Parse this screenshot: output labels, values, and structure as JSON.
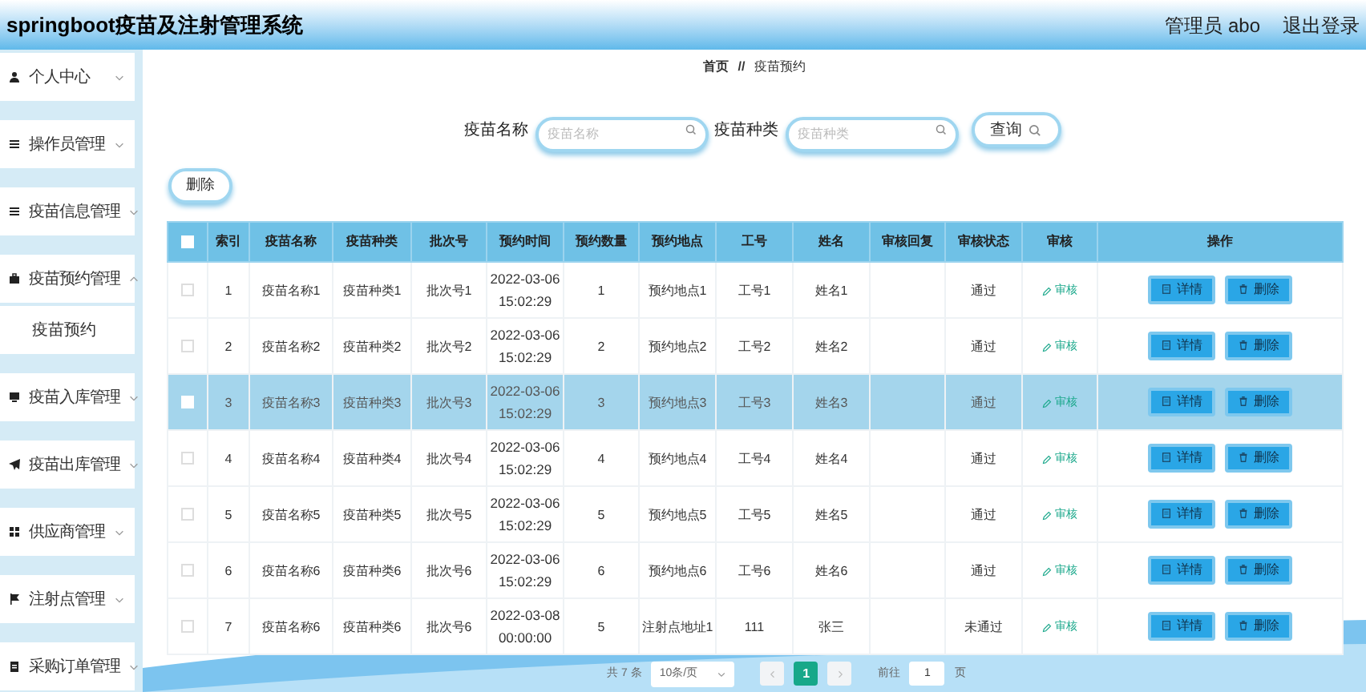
{
  "header": {
    "title": "springboot疫苗及注射管理系统",
    "user": "管理员 abo",
    "logout": "退出登录"
  },
  "sidebar": {
    "items": [
      {
        "label": "个人中心",
        "expanded": false
      },
      {
        "label": "操作员管理",
        "expanded": false
      },
      {
        "label": "疫苗信息管理",
        "expanded": false
      },
      {
        "label": "疫苗预约管理",
        "expanded": true,
        "children": [
          {
            "label": "疫苗预约"
          }
        ]
      },
      {
        "label": "疫苗入库管理",
        "expanded": false
      },
      {
        "label": "疫苗出库管理",
        "expanded": false
      },
      {
        "label": "供应商管理",
        "expanded": false
      },
      {
        "label": "注射点管理",
        "expanded": false
      },
      {
        "label": "采购订单管理",
        "expanded": false
      }
    ]
  },
  "breadcrumb": {
    "home": "首页",
    "separator": "//",
    "current": "疫苗预约"
  },
  "search": {
    "fields": [
      {
        "label": "疫苗名称",
        "placeholder": "疫苗名称"
      },
      {
        "label": "疫苗种类",
        "placeholder": "疫苗种类"
      }
    ],
    "button": "查询"
  },
  "delete_button": "删除",
  "table": {
    "columns": [
      "索引",
      "疫苗名称",
      "疫苗种类",
      "批次号",
      "预约时间",
      "预约数量",
      "预约地点",
      "工号",
      "姓名",
      "审核回复",
      "审核状态",
      "审核",
      "操作"
    ],
    "header_checked": false,
    "rows": [
      {
        "selected": false,
        "checked": false,
        "cells": [
          "1",
          "疫苗名称1",
          "疫苗种类1",
          "批次号1",
          "2022-03-06 15:02:29",
          "1",
          "预约地点1",
          "工号1",
          "姓名1",
          "",
          "通过"
        ],
        "review": "审核",
        "detail": "详情",
        "delete": "删除"
      },
      {
        "selected": false,
        "checked": false,
        "cells": [
          "2",
          "疫苗名称2",
          "疫苗种类2",
          "批次号2",
          "2022-03-06 15:02:29",
          "2",
          "预约地点2",
          "工号2",
          "姓名2",
          "",
          "通过"
        ],
        "review": "审核",
        "detail": "详情",
        "delete": "删除"
      },
      {
        "selected": true,
        "checked": false,
        "cells": [
          "3",
          "疫苗名称3",
          "疫苗种类3",
          "批次号3",
          "2022-03-06 15:02:29",
          "3",
          "预约地点3",
          "工号3",
          "姓名3",
          "",
          "通过"
        ],
        "review": "审核",
        "detail": "详情",
        "delete": "删除"
      },
      {
        "selected": false,
        "checked": false,
        "cells": [
          "4",
          "疫苗名称4",
          "疫苗种类4",
          "批次号4",
          "2022-03-06 15:02:29",
          "4",
          "预约地点4",
          "工号4",
          "姓名4",
          "",
          "通过"
        ],
        "review": "审核",
        "detail": "详情",
        "delete": "删除"
      },
      {
        "selected": false,
        "checked": false,
        "cells": [
          "5",
          "疫苗名称5",
          "疫苗种类5",
          "批次号5",
          "2022-03-06 15:02:29",
          "5",
          "预约地点5",
          "工号5",
          "姓名5",
          "",
          "通过"
        ],
        "review": "审核",
        "detail": "详情",
        "delete": "删除"
      },
      {
        "selected": false,
        "checked": false,
        "cells": [
          "6",
          "疫苗名称6",
          "疫苗种类6",
          "批次号6",
          "2022-03-06 15:02:29",
          "6",
          "预约地点6",
          "工号6",
          "姓名6",
          "",
          "通过"
        ],
        "review": "审核",
        "detail": "详情",
        "delete": "删除"
      },
      {
        "selected": false,
        "checked": false,
        "cells": [
          "7",
          "疫苗名称6",
          "疫苗种类6",
          "批次号6",
          "2022-03-08 00:00:00",
          "5",
          "注射点地址1",
          "111",
          "张三",
          "",
          "未通过"
        ],
        "review": "审核",
        "detail": "详情",
        "delete": "删除"
      }
    ]
  },
  "pagination": {
    "total": "共 7 条",
    "page_size": "10条/页",
    "pages": [
      {
        "label": "1",
        "selected": true
      }
    ],
    "goto_label": "前往",
    "goto_value": "1",
    "goto_suffix": "页"
  }
}
